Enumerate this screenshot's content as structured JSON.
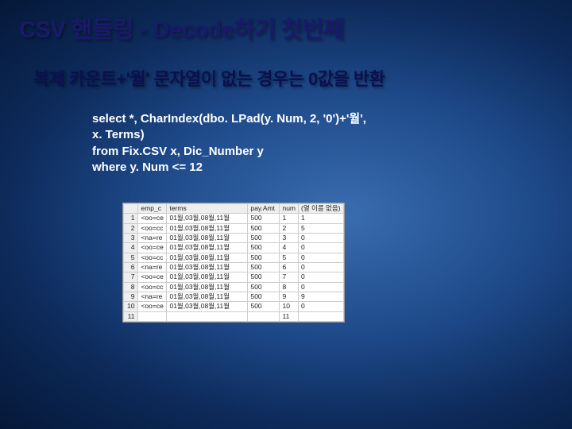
{
  "title": "CSV 핸들링 - Decode하기 첫번째",
  "subtitle": "복제 카운트+'월' 문자열이 없는 경우는 0값을 반환",
  "code": "select *, CharIndex(dbo. LPad(y. Num, 2, '0')+'월',\nx. Terms)\nfrom Fix.CSV x, Dic_Number y\nwhere y. Num <= 12",
  "table": {
    "headers": [
      "",
      "emp_c",
      "terms",
      "pay.Amt",
      "num",
      "(열 이름 없음)"
    ],
    "rows": [
      [
        "1",
        "<oo=ce",
        "01월,03월,08월,11월",
        "500",
        "1",
        "1"
      ],
      [
        "2",
        "<oo=cc",
        "01월,03월,08월,11월",
        "500",
        "2",
        "5"
      ],
      [
        "3",
        "<na=re",
        "01월,03월,08월,11월",
        "500",
        "3",
        "0"
      ],
      [
        "4",
        "<oo=ce",
        "01월,03월,08월,11월",
        "500",
        "4",
        "0"
      ],
      [
        "5",
        "<oo=cc",
        "01월,03월,08월,11월",
        "500",
        "5",
        "0"
      ],
      [
        "6",
        "<na=re",
        "01월,03월,08월,11월",
        "500",
        "6",
        "0"
      ],
      [
        "7",
        "<oo=ce",
        "01월,03월,08월,11월",
        "500",
        "7",
        "0"
      ],
      [
        "8",
        "<oo=cc",
        "01월,03월,08월,11월",
        "500",
        "8",
        "0"
      ],
      [
        "9",
        "<na=re",
        "01월,03월,08월,11월",
        "500",
        "9",
        "9"
      ],
      [
        "10",
        "<oo=ce",
        "01월,03월,08월,11월",
        "500",
        "10",
        "0"
      ],
      [
        "11",
        "",
        "",
        "",
        "11",
        ""
      ]
    ]
  }
}
